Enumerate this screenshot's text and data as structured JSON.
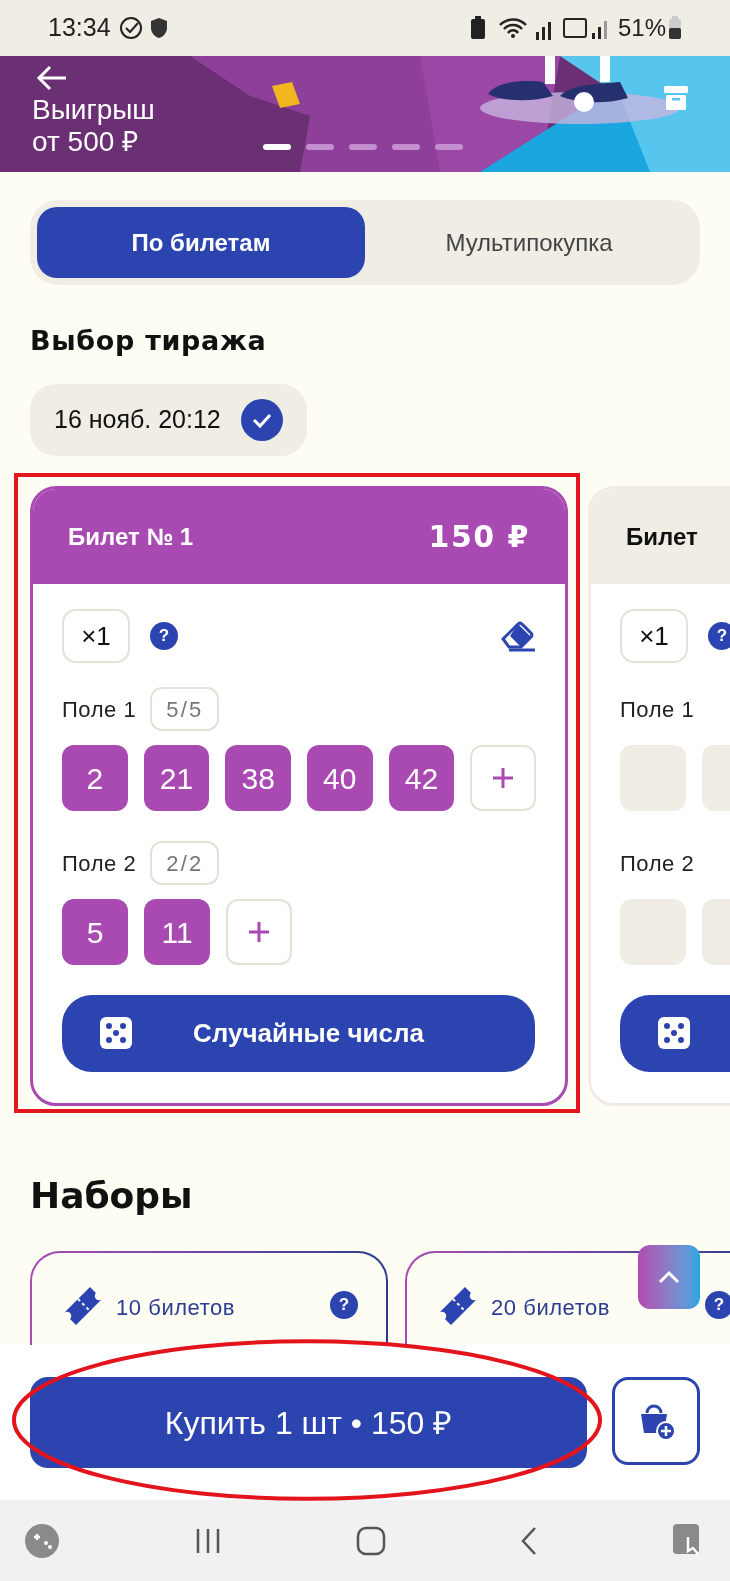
{
  "status_bar": {
    "time": "13:34",
    "battery": "51%"
  },
  "banner": {
    "title": "Выигрыш",
    "subtitle": "от 500 ₽",
    "dots": [
      {
        "selected": true
      },
      {
        "selected": false
      },
      {
        "selected": false
      },
      {
        "selected": false
      },
      {
        "selected": false
      }
    ]
  },
  "tabs": [
    {
      "label": "По билетам",
      "selected": true
    },
    {
      "label": "Мультипокупка",
      "selected": false
    }
  ],
  "draw_section": {
    "title": "Выбор тиража",
    "draws": [
      {
        "label": "16 нояб. 20:12",
        "selected": true
      }
    ]
  },
  "tickets": [
    {
      "title": "Билет № 1",
      "price": "150 ₽",
      "selected": true,
      "multiplier": "×1",
      "help": "?",
      "fields": [
        {
          "label": "Поле 1",
          "count": "5/5",
          "numbers": [
            "2",
            "21",
            "38",
            "40",
            "42"
          ]
        },
        {
          "label": "Поле 2",
          "count": "2/2",
          "numbers": [
            "5",
            "11"
          ]
        }
      ],
      "random_button": "Случайные числа"
    },
    {
      "title": "Билет",
      "selected": false,
      "multiplier": "×1",
      "help": "?",
      "fields": [
        {
          "label": "Поле 1"
        },
        {
          "label": "Поле 2"
        }
      ]
    }
  ],
  "sets": {
    "title": "Наборы",
    "items": [
      {
        "label": "10 билетов",
        "help": "?"
      },
      {
        "label": "20 билетов",
        "help": "?"
      }
    ]
  },
  "buy_button": "Купить 1 шт • 150 ₽",
  "annotations": [
    {
      "kind": "rectangle"
    },
    {
      "kind": "ellipse"
    }
  ]
}
